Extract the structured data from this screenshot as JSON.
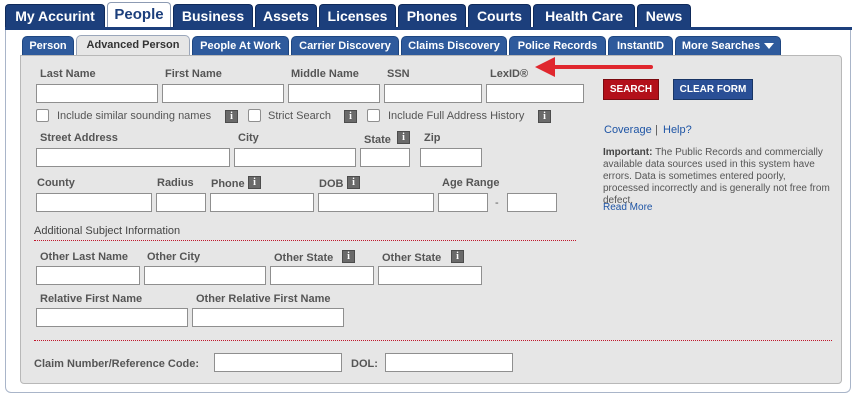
{
  "top_tabs": [
    "My Accurint",
    "People",
    "Business",
    "Assets",
    "Licenses",
    "Phones",
    "Courts",
    "Health Care",
    "News"
  ],
  "sub_tabs": [
    "Person",
    "Advanced Person",
    "People At Work",
    "Carrier Discovery",
    "Claims Discovery",
    "Police Records",
    "InstantID",
    "More Searches"
  ],
  "form": {
    "last_name": "Last Name",
    "first_name": "First Name",
    "middle_name": "Middle Name",
    "ssn": "SSN",
    "lexid": "LexID®",
    "similar_names": "Include similar sounding names",
    "strict_search": "Strict Search",
    "full_address_history": "Include Full Address History",
    "street_address": "Street Address",
    "city": "City",
    "state": "State",
    "zip": "Zip",
    "county": "County",
    "radius": "Radius",
    "phone": "Phone",
    "dob": "DOB",
    "age_range": "Age Range",
    "age_dash": "-",
    "additional_subject": "Additional Subject Information",
    "other_last_name": "Other Last Name",
    "other_city": "Other City",
    "other_state_1": "Other State",
    "other_state_2": "Other State",
    "relative_first_name": "Relative First Name",
    "other_relative_first_name": "Other Relative First Name",
    "claim_number": "Claim Number/Reference Code:",
    "dol": "DOL:"
  },
  "buttons": {
    "search": "SEARCH",
    "clear_form": "CLEAR FORM"
  },
  "links": {
    "coverage": "Coverage",
    "separator": "|",
    "help": "Help?",
    "read_more": "Read More"
  },
  "notice": {
    "heading": "Important:",
    "body": "The Public Records and commercially available data sources used in this system have errors. Data is sometimes entered poorly, processed incorrectly and is generally not free from defect."
  },
  "icons": {
    "info": "i"
  },
  "colors": {
    "nav_blue": "#1c3f7c",
    "search_red": "#b3101a",
    "clear_blue": "#2a4f96",
    "arrow_red": "#e0272e"
  }
}
